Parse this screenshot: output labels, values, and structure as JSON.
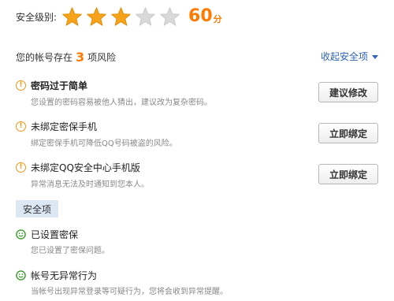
{
  "security_level": {
    "label": "安全级别:",
    "stars_filled": 3,
    "stars_total": 5,
    "score": "60",
    "score_unit": "分",
    "star_color": "#f7a21b",
    "star_empty_color": "#d9d9d9"
  },
  "risk_summary": {
    "prefix": "您的帐号存在",
    "count": "3",
    "suffix": "项风险",
    "collapse_label": "收起安全项"
  },
  "risk_items": [
    {
      "icon": "warning-icon",
      "title": "密码过于简单",
      "desc": "您设置的密码容易被他人猜出，建议改为复杂密码。",
      "button": "建议修改"
    },
    {
      "icon": "warning-icon",
      "title": "未绑定密保手机",
      "desc": "绑定密保手机可降低QQ号码被盗的风险。",
      "button": "立即绑定"
    },
    {
      "icon": "warning-icon",
      "title": "未绑定QQ安全中心手机版",
      "desc": "异常消息无法及时通知到您本人。",
      "button": "立即绑定"
    }
  ],
  "safe_section": {
    "tag": "安全项",
    "items": [
      {
        "icon": "smile-icon",
        "title": "已设置密保",
        "desc": "您已设置了密保问题。"
      },
      {
        "icon": "smile-icon",
        "title": "帐号无异常行为",
        "desc": "当帐号出现异常登录等可疑行为，您将会收到异常提醒。"
      }
    ]
  },
  "colors": {
    "accent_orange": "#ff7a00",
    "warning": "#f0960f",
    "safe_green": "#3a9a2c",
    "link_blue": "#2d64b3",
    "tag_bg": "#dbe7f3"
  }
}
